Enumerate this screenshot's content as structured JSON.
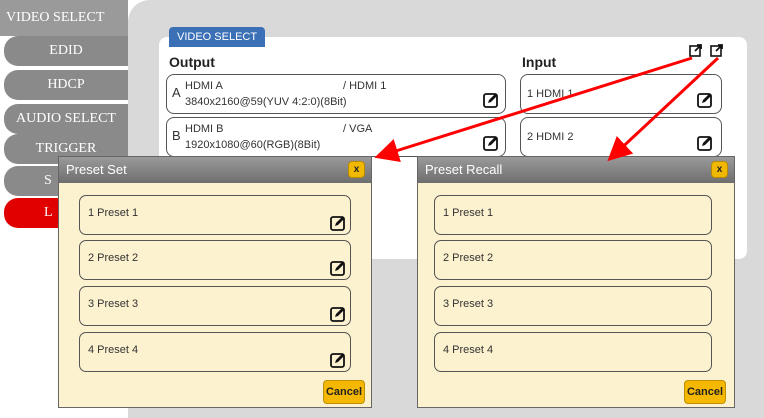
{
  "sidebar": {
    "items": [
      {
        "label": "VIDEO SELECT"
      },
      {
        "label": "EDID"
      },
      {
        "label": "HDCP"
      },
      {
        "label": "AUDIO SELECT"
      },
      {
        "label": "TRIGGER"
      },
      {
        "label": "S"
      },
      {
        "label": "L"
      }
    ]
  },
  "card": {
    "tab_label": "VIDEO SELECT",
    "output_title": "Output",
    "input_title": "Input",
    "outputs": [
      {
        "letter": "A",
        "name": "HDMI A",
        "source": "/ HDMI 1",
        "format": "3840x2160@59(YUV 4:2:0)(8Bit)"
      },
      {
        "letter": "B",
        "name": "HDMI B",
        "source": "/ VGA",
        "format": "1920x1080@60(RGB)(8Bit)"
      }
    ],
    "inputs": [
      {
        "label": "1  HDMI 1"
      },
      {
        "label": "2  HDMI 2"
      }
    ]
  },
  "preset_set": {
    "title": "Preset Set",
    "close_label": "x",
    "items": [
      "1  Preset 1",
      "2  Preset 2",
      "3  Preset 3",
      "4  Preset 4"
    ],
    "cancel_label": "Cancel"
  },
  "preset_recall": {
    "title": "Preset Recall",
    "close_label": "x",
    "items": [
      "1  Preset 1",
      "2  Preset 2",
      "3  Preset 3",
      "4  Preset 4"
    ],
    "cancel_label": "Cancel"
  },
  "colors": {
    "active_nav": "#e00000",
    "nav": "#8a8a8a",
    "tab": "#3b6fb6",
    "dialog_bg": "#fdf2cf",
    "button": "#f5b800",
    "arrow": "#ff0000"
  },
  "icons": [
    "edit-icon",
    "preset-set-icon",
    "preset-recall-icon",
    "close-icon"
  ]
}
